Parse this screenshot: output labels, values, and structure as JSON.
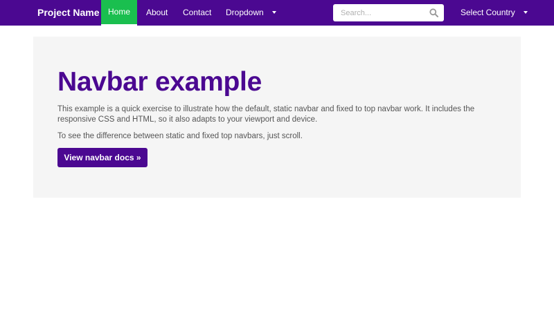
{
  "navbar": {
    "brand": "Project Name",
    "links": [
      {
        "label": "Home",
        "active": true
      },
      {
        "label": "About"
      },
      {
        "label": "Contact"
      },
      {
        "label": "Dropdown"
      }
    ],
    "search": {
      "placeholder": "Search...",
      "value": "",
      "icon": "search-icon"
    },
    "country_label": "Select Country",
    "colors": {
      "background": "#4b0891",
      "active": "#1abf4f"
    }
  },
  "jumbotron": {
    "title": "Navbar example",
    "paragraph_1": "This example is a quick exercise to illustrate how the default, static navbar and fixed to top navbar work. It includes the responsive CSS and HTML, so it also adapts to your viewport and device.",
    "paragraph_2": "To see the difference between static and fixed top navbars, just scroll.",
    "button_label": "View navbar docs »",
    "colors": {
      "background": "#f5f5f5",
      "accent": "#4b0891"
    }
  }
}
